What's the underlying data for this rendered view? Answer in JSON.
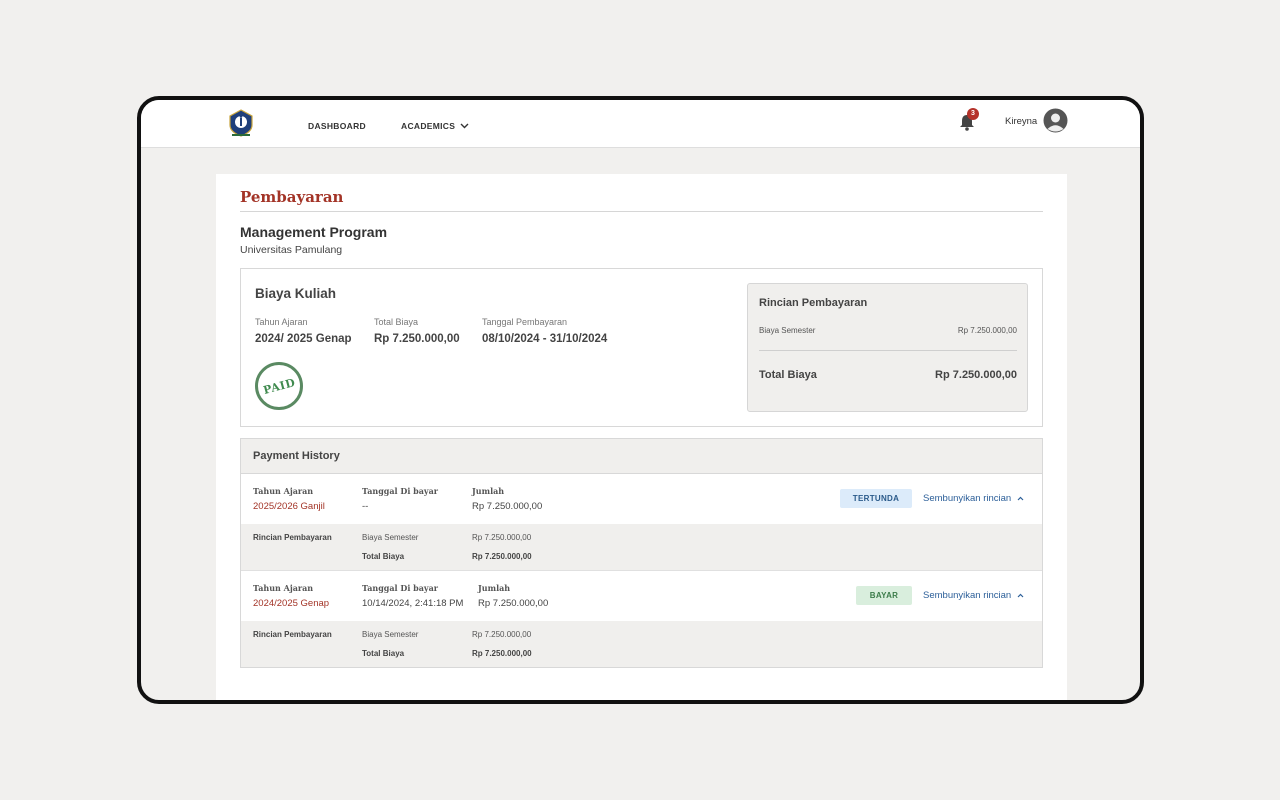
{
  "nav": {
    "dashboard": "DASHBOARD",
    "academics": "ACADEMICS",
    "notification_count": "3",
    "user_name": "Kireyna"
  },
  "page": {
    "title": "Pembayaran",
    "program": "Management Program",
    "university": "Universitas Pamulang"
  },
  "fee": {
    "title": "Biaya Kuliah",
    "year_label": "Tahun Ajaran",
    "year_value": "2024/ 2025 Genap",
    "total_label": "Total Biaya",
    "total_value": "Rp 7.250.000,00",
    "date_label": "Tanggal Pembayaran",
    "date_value": "08/10/2024 - 31/10/2024",
    "stamp": "PAID"
  },
  "rincian": {
    "title": "Rincian Pembayaran",
    "item_label": "Biaya Semester",
    "item_value": "Rp 7.250.000,00",
    "total_label": "Total Biaya",
    "total_value": "Rp 7.250.000,00"
  },
  "history": {
    "title": "Payment History",
    "rows": [
      {
        "year_label": "Tahun Ajaran",
        "year_value": "2025/2026 Ganjil",
        "date_label": "Tanggal Di bayar",
        "date_value": "--",
        "amount_label": "Jumlah",
        "amount_value": "Rp 7.250.000,00",
        "status": "TERTUNDA",
        "toggle": "Sembunyikan rincian",
        "detail_label": "Rincian Pembayaran",
        "detail_item": "Biaya Semester",
        "detail_item_value": "Rp 7.250.000,00",
        "detail_total": "Total Biaya",
        "detail_total_value": "Rp 7.250.000,00"
      },
      {
        "year_label": "Tahun Ajaran",
        "year_value": "2024/2025 Genap",
        "date_label": "Tanggal Di bayar",
        "date_value": "10/14/2024, 2:41:18 PM",
        "amount_label": "Jumlah",
        "amount_value": "Rp 7.250.000,00",
        "status": "BAYAR",
        "toggle": "Sembunyikan rincian",
        "detail_label": "Rincian Pembayaran",
        "detail_item": "Biaya Semester",
        "detail_item_value": "Rp 7.250.000,00",
        "detail_total": "Total Biaya",
        "detail_total_value": "Rp 7.250.000,00"
      }
    ]
  },
  "colors": {
    "accent": "#a33427",
    "link": "#2c5f99",
    "paid": "#3f8a4e"
  },
  "icons": [
    "university-logo-icon",
    "chevron-down-icon",
    "bell-icon",
    "avatar-icon",
    "chevron-up-icon"
  ]
}
